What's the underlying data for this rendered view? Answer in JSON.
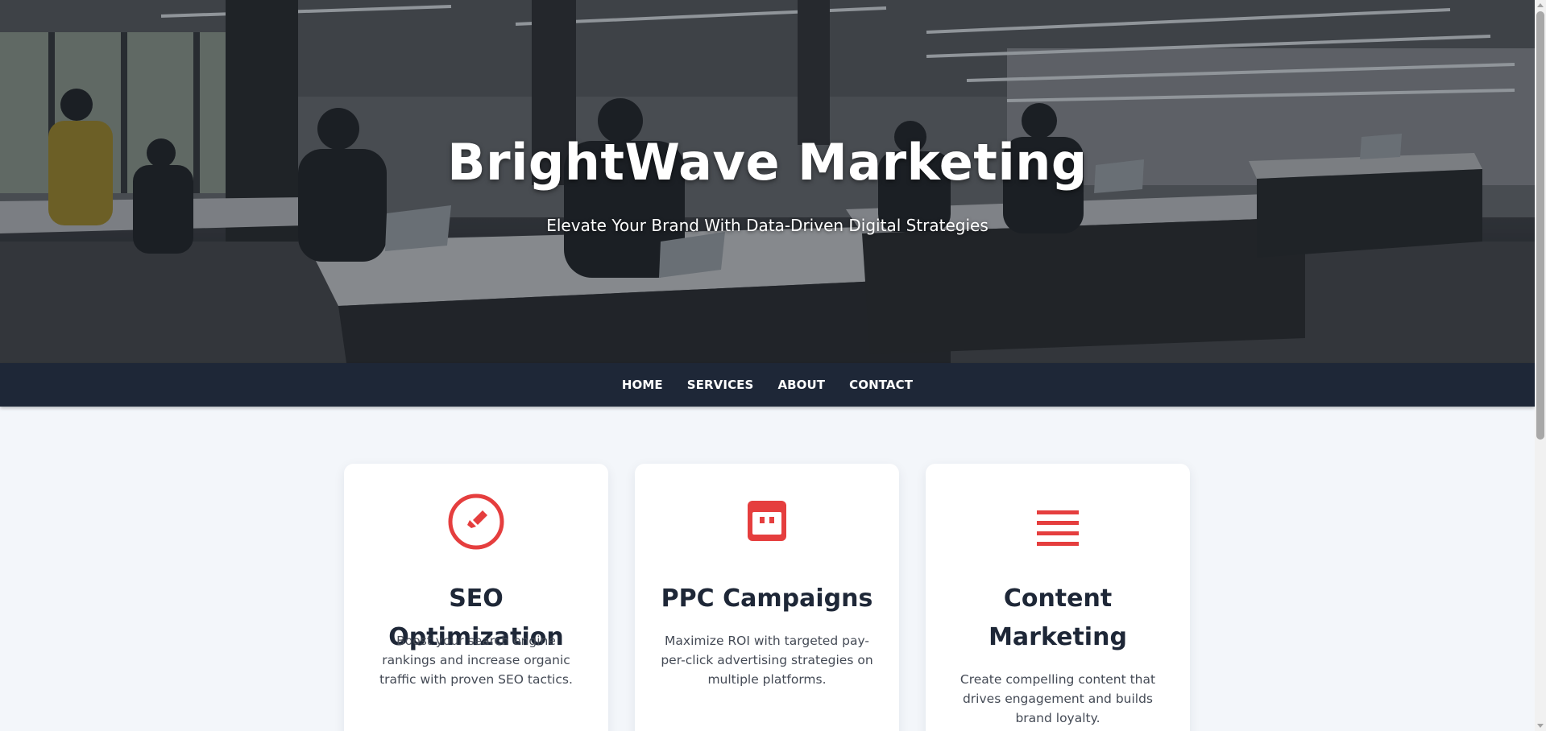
{
  "hero": {
    "title": "BrightWave Marketing",
    "subtitle": "Elevate Your Brand With Data-Driven Digital Strategies"
  },
  "nav": {
    "items": [
      {
        "label": "HOME"
      },
      {
        "label": "SERVICES"
      },
      {
        "label": "ABOUT"
      },
      {
        "label": "CONTACT"
      }
    ]
  },
  "services": [
    {
      "icon": "compass-icon",
      "title": "SEO Optimization",
      "description": "Boost your search engine rankings and increase organic traffic with proven SEO tactics."
    },
    {
      "icon": "ad-window-icon",
      "title": "PPC Campaigns",
      "description": "Maximize ROI with targeted pay-per-click advertising strategies on multiple platforms."
    },
    {
      "icon": "text-lines-icon",
      "title": "Content Marketing",
      "description": "Create compelling content that drives engagement and builds brand loyalty."
    }
  ],
  "colors": {
    "accent": "#e53e3e",
    "nav_background": "#1e2737",
    "page_background": "#f3f6fa",
    "heading": "#1e2737"
  }
}
